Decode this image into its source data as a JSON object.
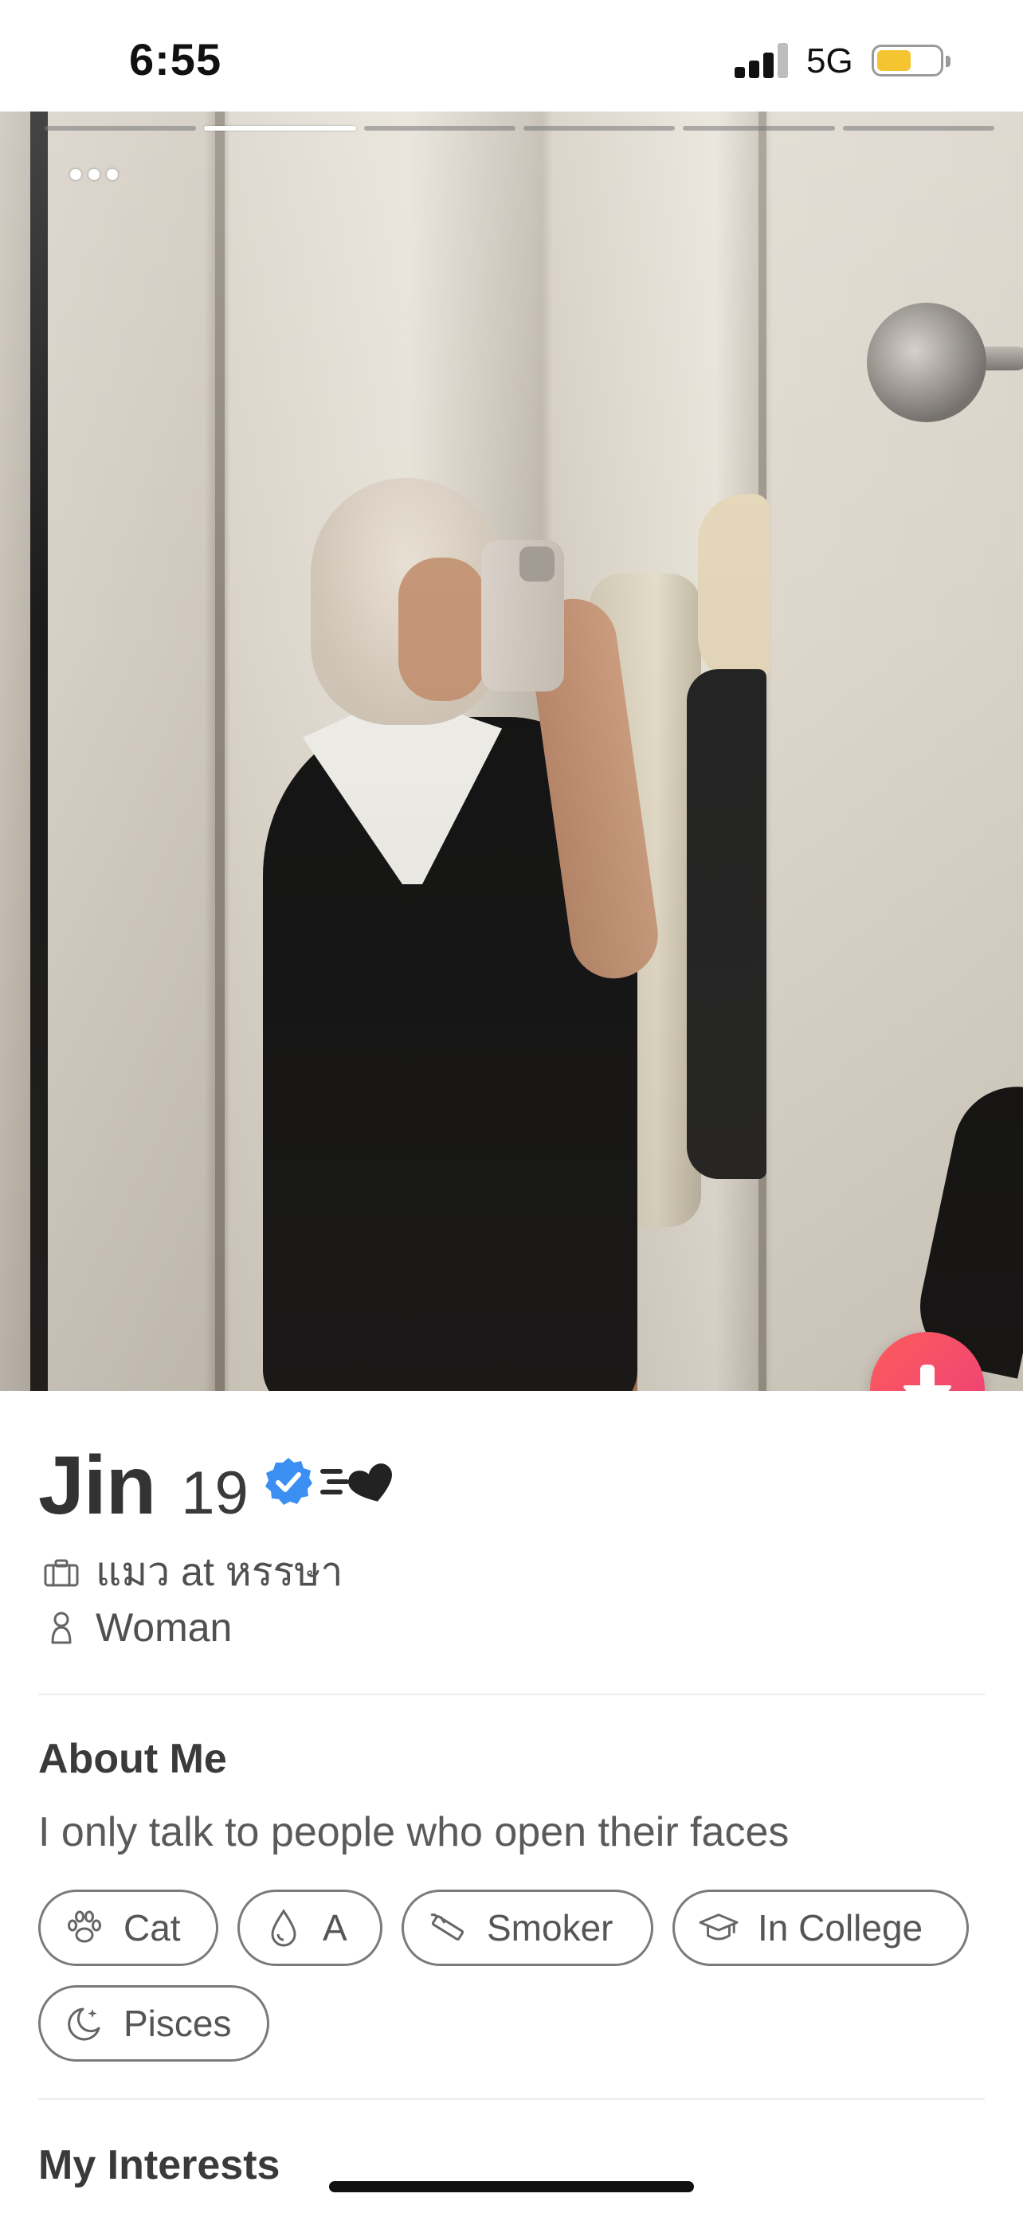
{
  "status_bar": {
    "time": "6:55",
    "network": "5G",
    "battery_level": 0.55
  },
  "photo": {
    "total_photos": 6,
    "active_index": 1
  },
  "profile": {
    "name": "Jin",
    "age": "19",
    "verified": true,
    "job": "แมว at หรรษา",
    "gender": "Woman"
  },
  "about": {
    "title": "About Me",
    "text": "I only talk to people who open their faces",
    "chips": [
      {
        "label": "Cat",
        "icon": "paw-icon"
      },
      {
        "label": "A",
        "icon": "blood-drop-icon"
      },
      {
        "label": "Smoker",
        "icon": "cigarette-icon"
      },
      {
        "label": "In College",
        "icon": "graduation-cap-icon"
      },
      {
        "label": "Pisces",
        "icon": "moon-stars-icon"
      }
    ]
  },
  "interests": {
    "title": "My Interests"
  },
  "colors": {
    "accent_gradient_start": "#fe5c5c",
    "accent_gradient_end": "#ea3e7a",
    "verified_blue": "#3b8ff3",
    "battery": "#f4c531"
  }
}
